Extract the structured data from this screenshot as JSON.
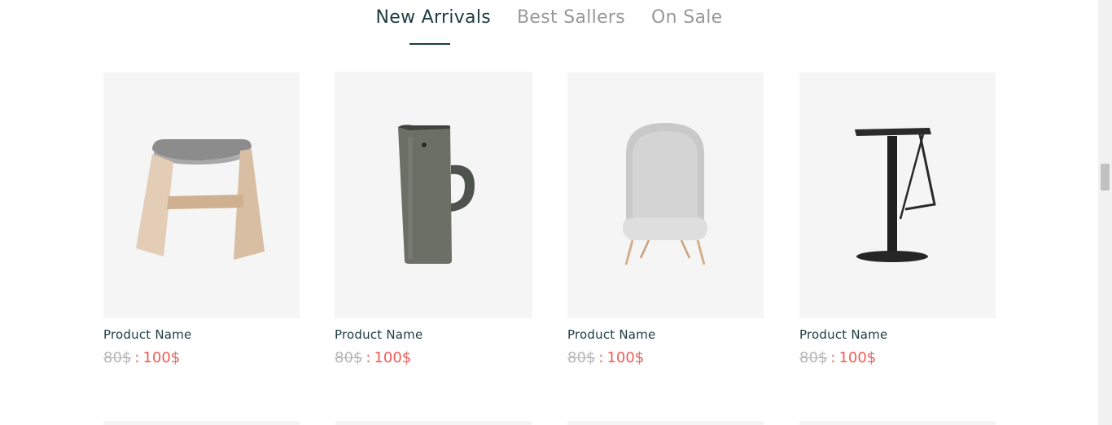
{
  "tabs": [
    {
      "label": "New Arrivals",
      "active": true
    },
    {
      "label": "Best Sallers",
      "active": false
    },
    {
      "label": "On Sale",
      "active": false
    }
  ],
  "products": [
    {
      "name": "Product Name",
      "old_price": "80$",
      "separator": ":",
      "new_price": "100$",
      "image_icon": "wooden-stool-icon"
    },
    {
      "name": "Product Name",
      "old_price": "80$",
      "separator": ":",
      "new_price": "100$",
      "image_icon": "jug-icon"
    },
    {
      "name": "Product Name",
      "old_price": "80$",
      "separator": ":",
      "new_price": "100$",
      "image_icon": "lounge-chair-icon"
    },
    {
      "name": "Product Name",
      "old_price": "80$",
      "separator": ":",
      "new_price": "100$",
      "image_icon": "bar-stool-icon"
    }
  ],
  "colors": {
    "accent": "#1d3c40",
    "inactive_tab": "#999999",
    "sale_price": "#f25c54",
    "old_price": "#b5b5b5",
    "card_bg": "#f5f5f5"
  }
}
